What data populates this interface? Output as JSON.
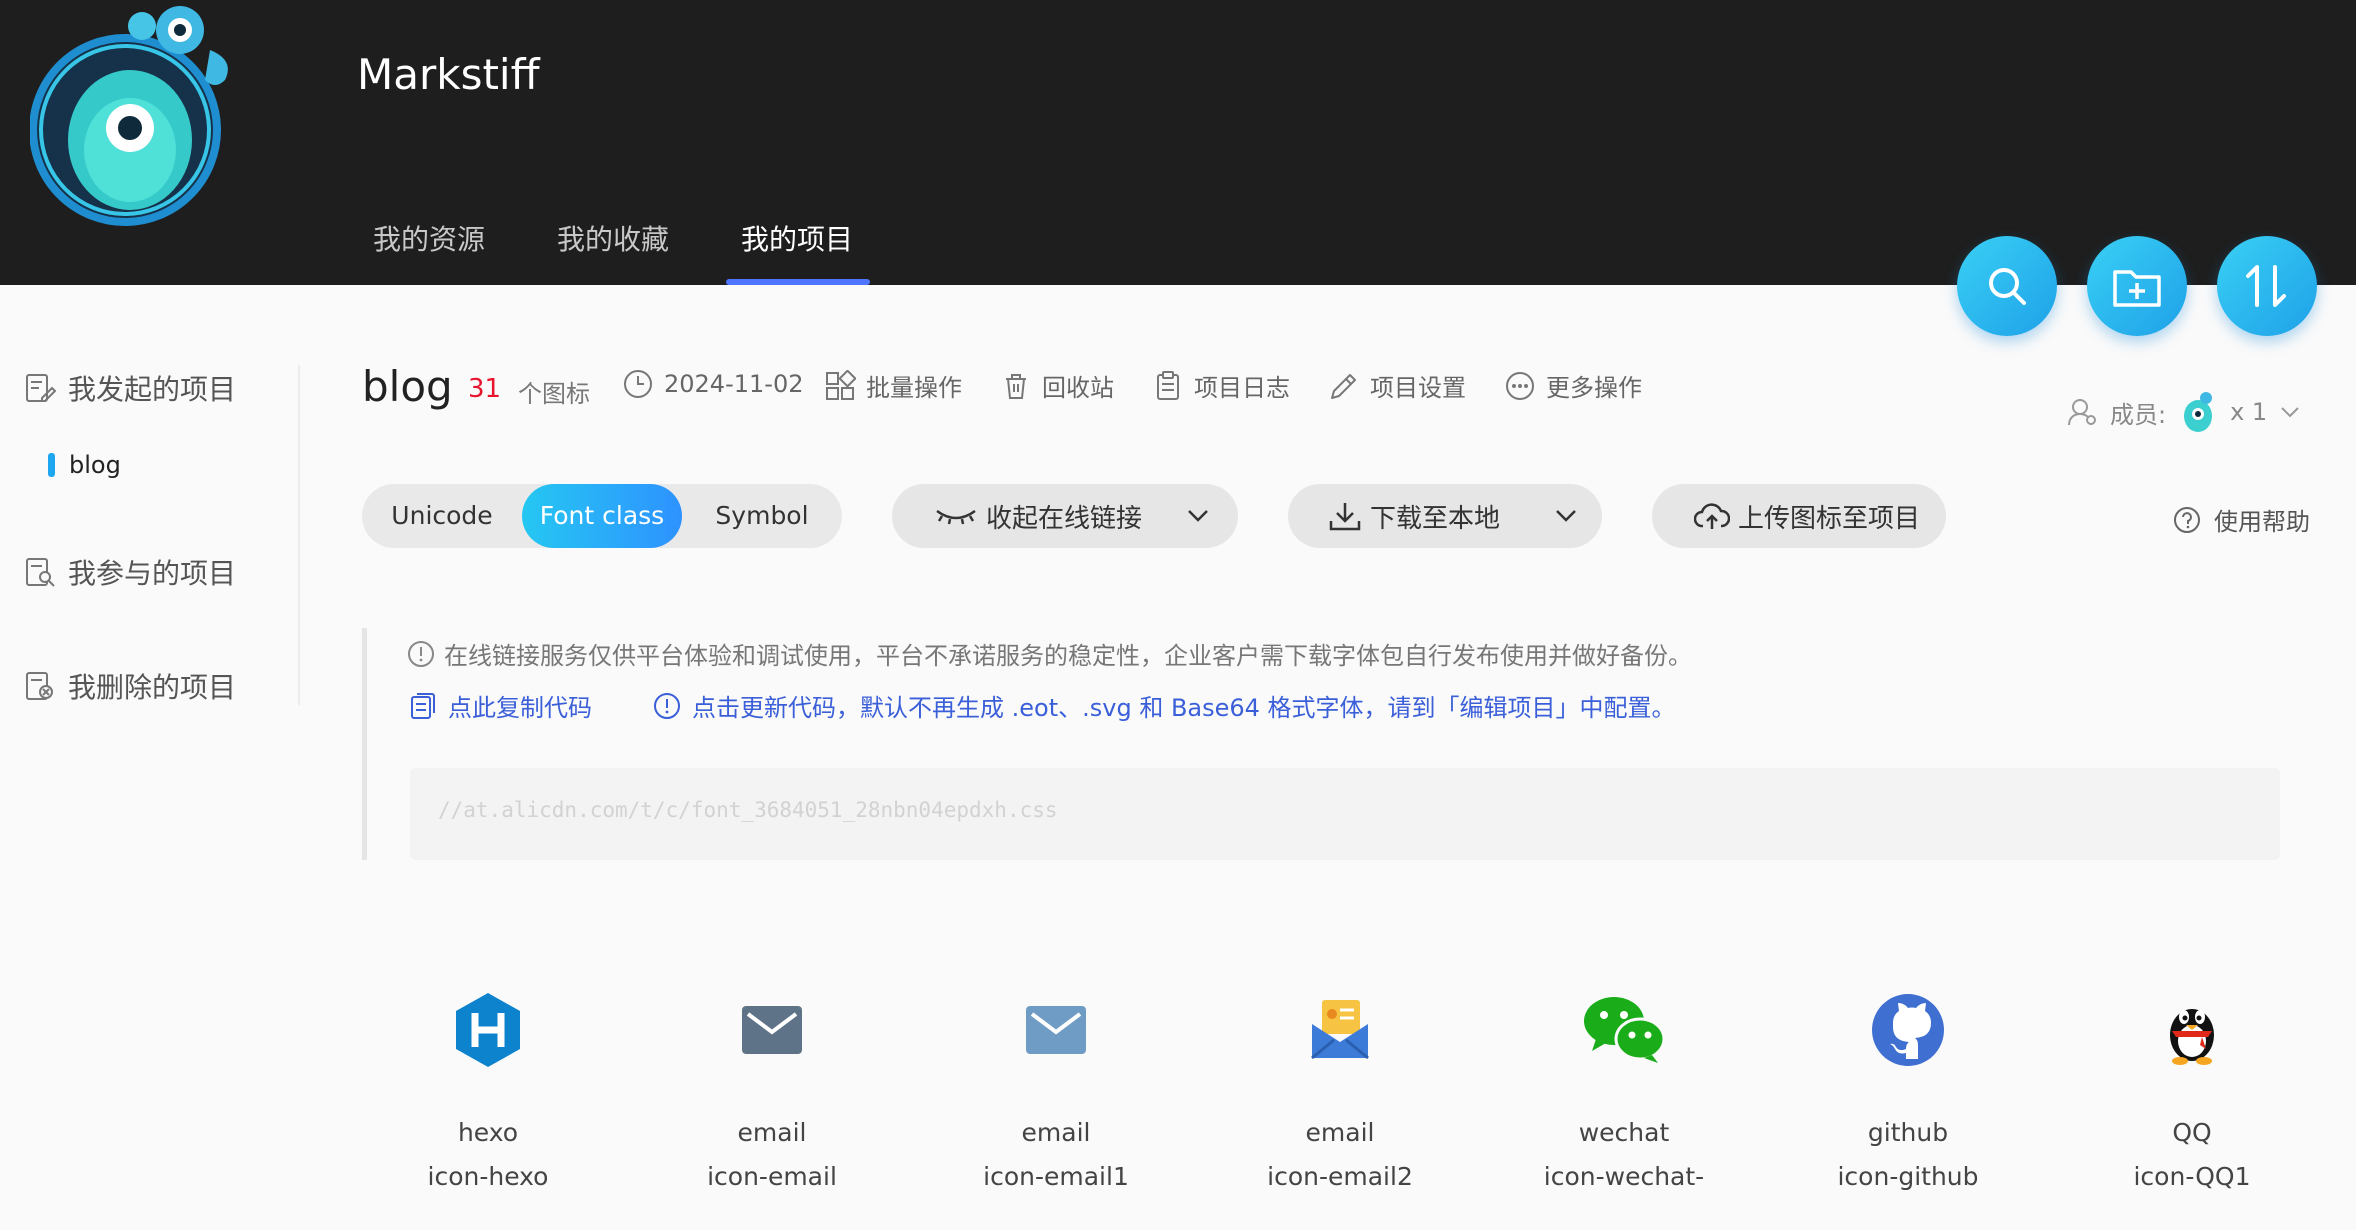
{
  "header": {
    "user_name": "Markstiff",
    "tabs": [
      {
        "label": "我的资源",
        "active": false
      },
      {
        "label": "我的收藏",
        "active": false
      },
      {
        "label": "我的项目",
        "active": true
      }
    ],
    "fab_icons": [
      "search-icon",
      "new-folder-icon",
      "sort-icon"
    ]
  },
  "sidebar": {
    "initiated": {
      "label": "我发起的项目",
      "icon": "edit-doc-icon"
    },
    "sub_items": [
      {
        "label": "blog"
      }
    ],
    "participated": {
      "label": "我参与的项目",
      "icon": "search-doc-icon"
    },
    "deleted": {
      "label": "我删除的项目",
      "icon": "delete-doc-icon"
    }
  },
  "project": {
    "title": "blog",
    "icon_count": "31",
    "icon_unit": "个图标",
    "date": "2024-11-02",
    "actions": {
      "batch": "批量操作",
      "recycle": "回收站",
      "log": "项目日志",
      "settings": "项目设置",
      "more": "更多操作"
    },
    "members_label": "成员:",
    "members_count": "x 1"
  },
  "toolbar": {
    "segments": [
      {
        "label": "Unicode",
        "active": false
      },
      {
        "label": "Font class",
        "active": true
      },
      {
        "label": "Symbol",
        "active": false
      }
    ],
    "collapse_link": "收起在线链接",
    "download": "下载至本地",
    "upload": "上传图标至项目",
    "help": "使用帮助"
  },
  "notice": {
    "warning": "在线链接服务仅供平台体验和调试使用，平台不承诺服务的稳定性，企业客户需下载字体包自行发布使用并做好备份。",
    "copy_code": "点此复制代码",
    "update_code": "点击更新代码，默认不再生成 .eot、.svg 和 Base64 格式字体，请到「编辑项目」中配置。",
    "code_url": "//at.alicdn.com/t/c/font_3684051_28nbn04epdxh.css"
  },
  "icons": [
    {
      "name": "hexo",
      "class": "icon-hexo",
      "icon": "hexo-icon",
      "color": "#0e83cd"
    },
    {
      "name": "email",
      "class": "icon-email",
      "icon": "mail-icon",
      "color": "#5f7388"
    },
    {
      "name": "email",
      "class": "icon-email1",
      "icon": "mail-icon",
      "color": "#6e9cc4"
    },
    {
      "name": "email",
      "class": "icon-email2",
      "icon": "mail-money-icon",
      "color": "#3d7bd9"
    },
    {
      "name": "wechat",
      "class": "icon-wechat-",
      "icon": "wechat-icon",
      "color": "#1aad19"
    },
    {
      "name": "github",
      "class": "icon-github",
      "icon": "github-icon",
      "color": "#3f6fd0"
    },
    {
      "name": "QQ",
      "class": "icon-QQ1",
      "icon": "qq-icon",
      "color": "#111111"
    }
  ]
}
